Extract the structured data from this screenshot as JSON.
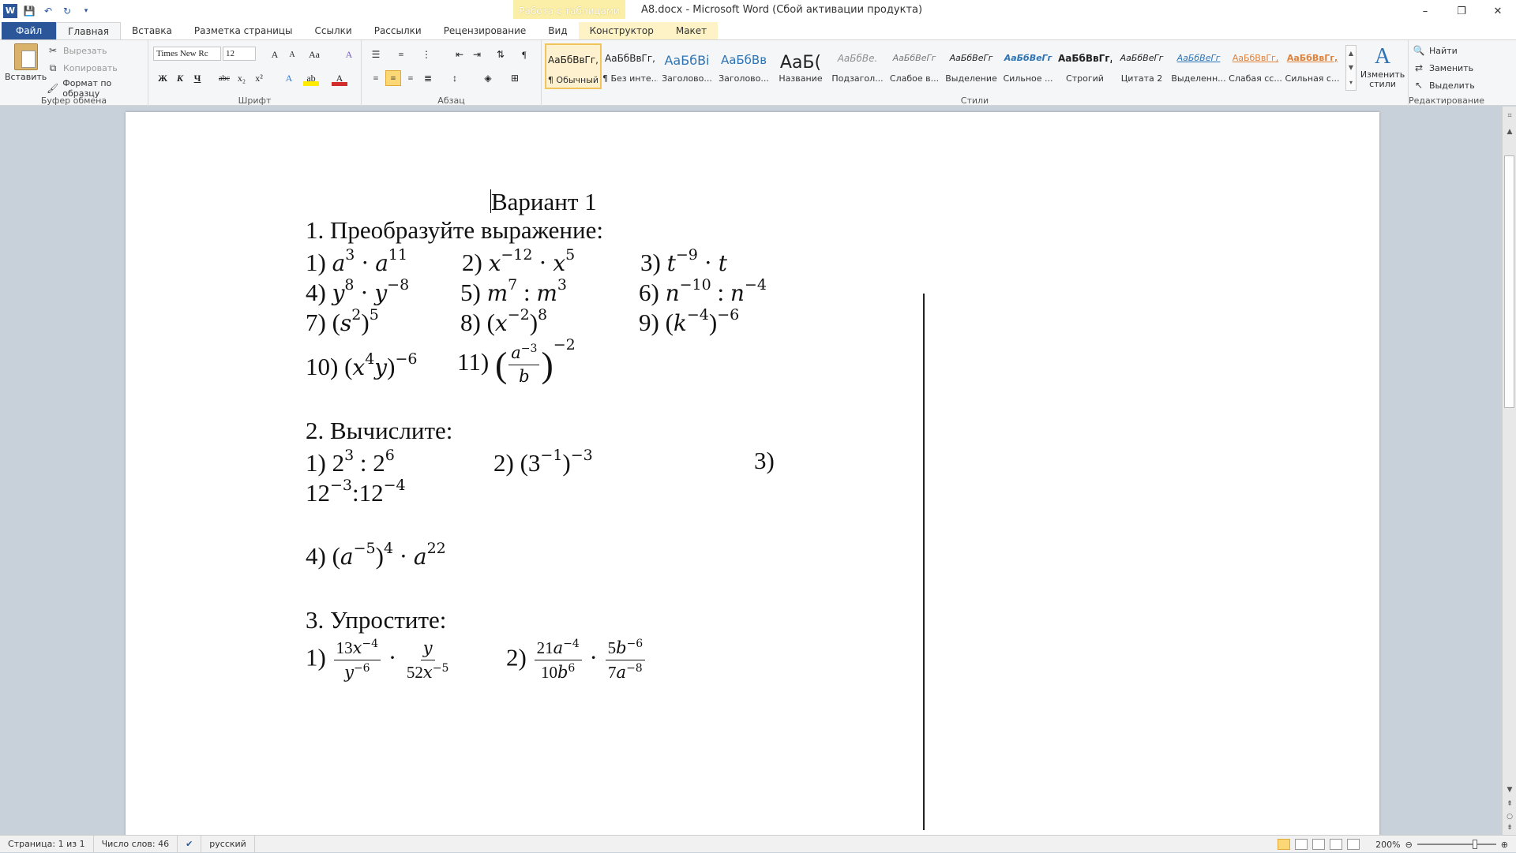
{
  "titlebar": {
    "context_tab": "Работа с таблицами",
    "window_title": "A8.docx  -  Microsoft Word (Сбой активации продукта)",
    "minimize": "–",
    "restore": "❐",
    "close": "✕"
  },
  "tabs": [
    "Главная",
    "Вставка",
    "Разметка страницы",
    "Ссылки",
    "Рассылки",
    "Рецензирование",
    "Вид",
    "Конструктор",
    "Макет"
  ],
  "file_tab": "Файл",
  "ribbon": {
    "clipboard": {
      "label": "Буфер обмена",
      "paste": "Вставить",
      "cut": "Вырезать",
      "copy": "Копировать",
      "format_painter": "Формат по образцу"
    },
    "font": {
      "label": "Шрифт",
      "font_name": "Times New Rc",
      "font_size": "12",
      "bold": "Ж",
      "italic": "К",
      "underline": "Ч",
      "strike": "abc",
      "subscript": "x₂",
      "superscript": "x²",
      "grow": "A",
      "shrink": "A",
      "case": "Aa",
      "clear": "A",
      "effects": "A",
      "highlight": "ab",
      "color": "A"
    },
    "paragraph": {
      "label": "Абзац"
    },
    "styles": {
      "label": "Стили",
      "change_styles": "Изменить стили",
      "items": [
        {
          "sample": "АаБбВвГг,",
          "name": "¶ Обычный"
        },
        {
          "sample": "АаБбВвГг,",
          "name": "¶ Без инте..."
        },
        {
          "sample": "АаБбВі",
          "name": "Заголово..."
        },
        {
          "sample": "АаБбВв",
          "name": "Заголово..."
        },
        {
          "sample": "АаБ(",
          "name": "Название"
        },
        {
          "sample": "АаБбВе.",
          "name": "Подзагол..."
        },
        {
          "sample": "АаБбВеГг",
          "name": "Слабое в..."
        },
        {
          "sample": "АаБбВеГг",
          "name": "Выделение"
        },
        {
          "sample": "АаБбВеГг",
          "name": "Сильное ..."
        },
        {
          "sample": "АаБбВвГг,",
          "name": "Строгий"
        },
        {
          "sample": "АаБбВеГг",
          "name": "Цитата 2"
        },
        {
          "sample": "АаБбВеГг",
          "name": "Выделенн..."
        },
        {
          "sample": "АаБбВвГг,",
          "name": "Слабая сс..."
        },
        {
          "sample": "АаБбВвГг,",
          "name": "Сильная с..."
        }
      ]
    },
    "editing": {
      "label": "Редактирование",
      "find": "Найти",
      "replace": "Заменить",
      "select": "Выделить"
    }
  },
  "document": {
    "title": "Вариант 1",
    "s1_heading": "1. Преобразуйте выражение:",
    "s1_rows": [
      [
        "1) ",
        "2) ",
        "3) "
      ],
      [
        "4) ",
        "5) ",
        "6) "
      ],
      [
        "7) ",
        "8) ",
        "9) "
      ],
      [
        "10) ",
        "11) "
      ]
    ],
    "s2_heading": "2. Вычислите:",
    "s2_n1": "1) ",
    "s2_n2": "2) ",
    "s2_n3": "3)",
    "s2_n4": "4) ",
    "s3_heading": "3. Упростите:",
    "s3_n1": "1) ",
    "s3_n2": "2) "
  },
  "statusbar": {
    "page": "Страница: 1 из 1",
    "words": "Число слов: 46",
    "language": "русский",
    "zoom": "200%"
  }
}
